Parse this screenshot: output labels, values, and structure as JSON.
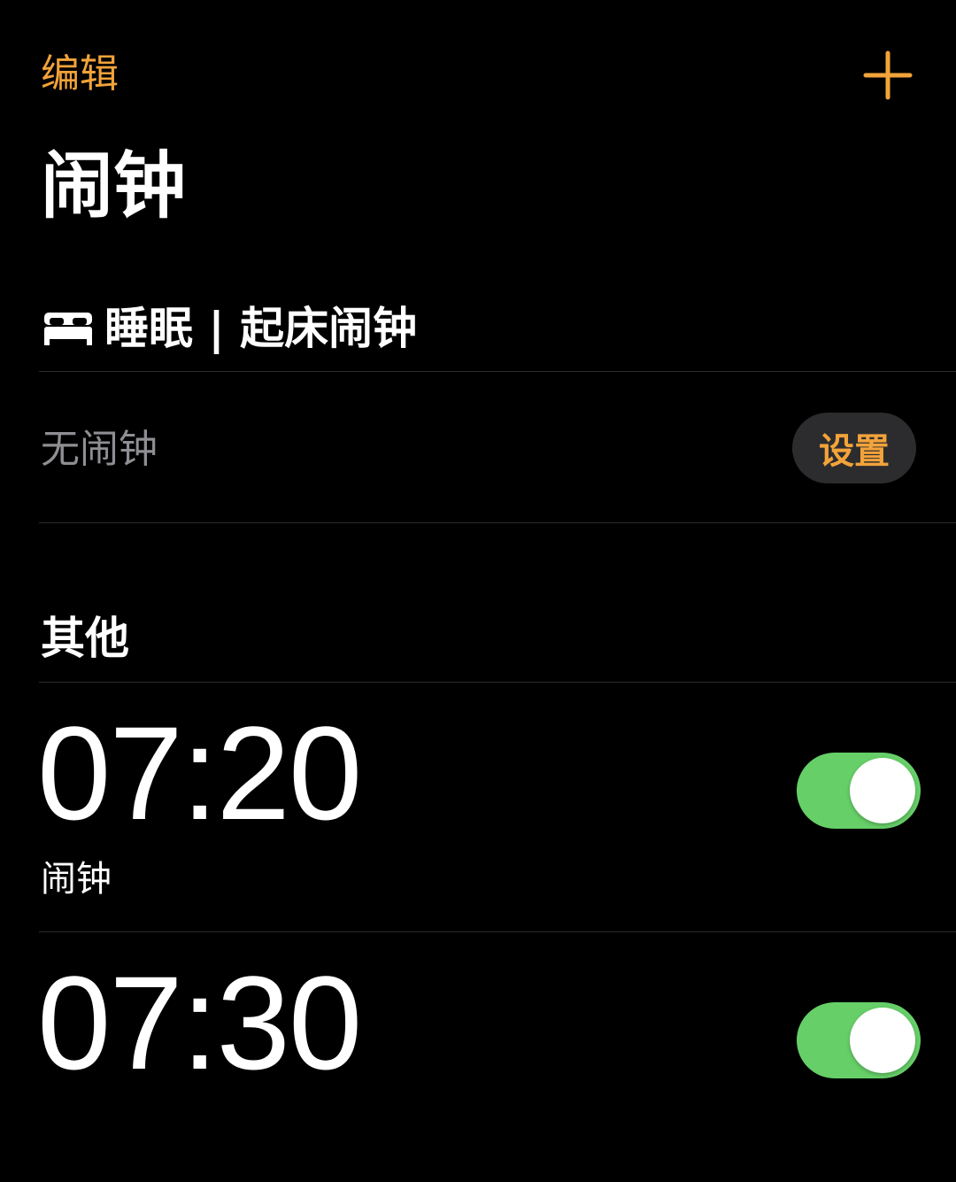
{
  "header": {
    "edit_label": "编辑",
    "add_icon": "plus-icon",
    "title": "闹钟"
  },
  "sleep": {
    "icon": "bed-icon",
    "title": "睡眠 | 起床闹钟",
    "status": "无闹钟",
    "set_label": "设置"
  },
  "other": {
    "title": "其他",
    "alarms": [
      {
        "time": "07:20",
        "label": "闹钟",
        "enabled": true
      },
      {
        "time": "07:30",
        "label": "",
        "enabled": true
      }
    ]
  },
  "colors": {
    "accent": "#f2a33a",
    "toggle_on": "#66cf68",
    "background": "#000000",
    "secondary_text": "#8e8e93",
    "button_bg": "#2c2c2e"
  }
}
